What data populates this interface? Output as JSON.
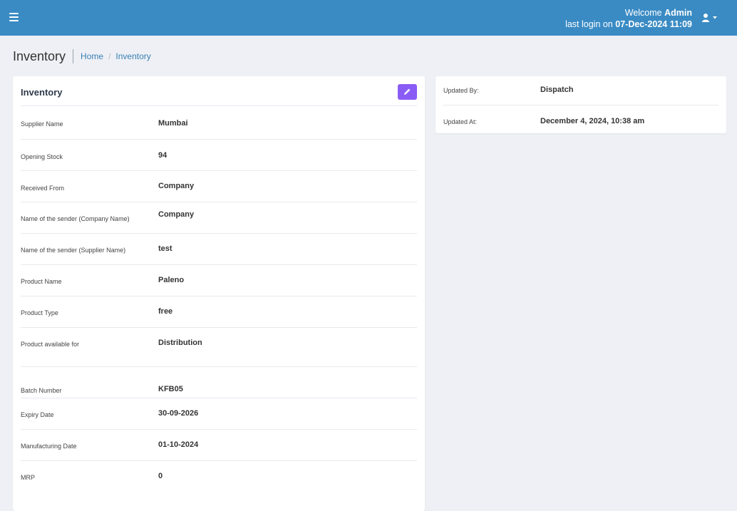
{
  "header": {
    "welcome_prefix": "Welcome",
    "user": "Admin",
    "last_login_prefix": "last login on",
    "last_login": "07-Dec-2024 11:09",
    "icons": {
      "menu": "hamburger-icon",
      "user": "user-icon",
      "caret": "caret-down-icon"
    },
    "color": "#3a8bc4"
  },
  "page": {
    "title": "Inventory",
    "breadcrumb": [
      "Home",
      "Inventory"
    ]
  },
  "details_card": {
    "title": "Inventory",
    "edit_icon": "pencil-icon",
    "edit_color": "#8a5cf6",
    "fields": [
      {
        "label": "Supplier Name",
        "value": "Mumbai"
      },
      {
        "label": "Opening Stock",
        "value": "94"
      },
      {
        "label": "Received From",
        "value": "Company"
      },
      {
        "label": "Name of the sender (Company Name)",
        "value": "Company"
      },
      {
        "label": "Name of the sender (Supplier Name)",
        "value": "test"
      },
      {
        "label": "Product Name",
        "value": "Paleno"
      },
      {
        "label": "Product Type",
        "value": "free"
      },
      {
        "label": "Product available for",
        "value": "Distribution"
      },
      {
        "label": "Batch Number",
        "value": "KFB05"
      },
      {
        "label": "Expiry Date",
        "value": "30-09-2026"
      },
      {
        "label": "Manufacturing Date",
        "value": "01-10-2024"
      },
      {
        "label": "MRP",
        "value": "0"
      }
    ]
  },
  "meta_card": {
    "updated_by_label": "Updated By:",
    "updated_by": "Dispatch",
    "updated_at_label": "Updated At:",
    "updated_at": "December 4, 2024, 10:38 am"
  }
}
